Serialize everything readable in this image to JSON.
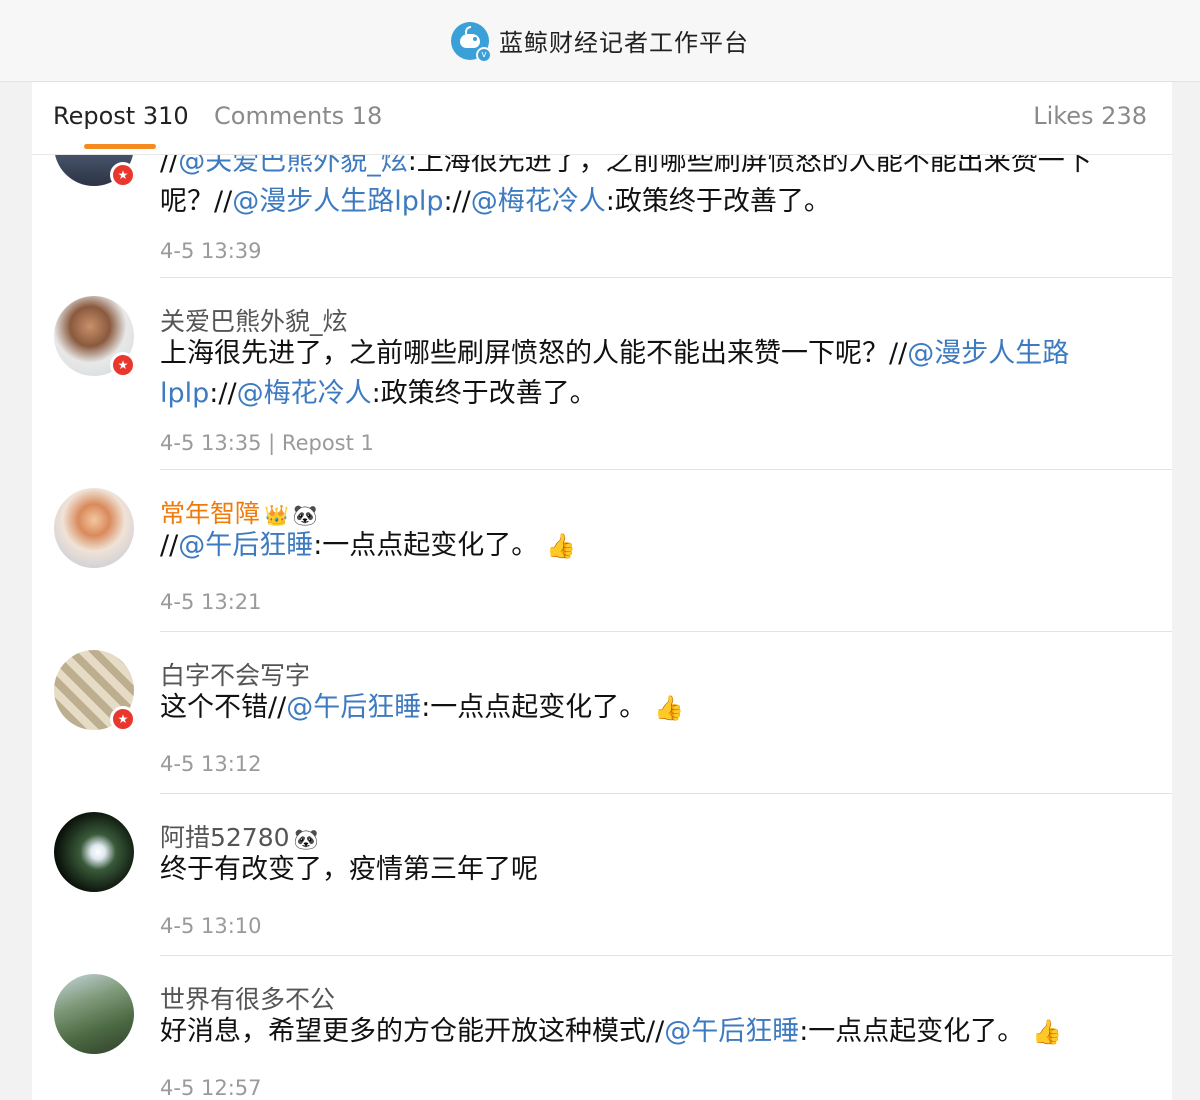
{
  "header": {
    "title": "蓝鲸财经记者工作平台",
    "logo_icon": "whale-logo-icon",
    "verified_mark": "v"
  },
  "tabs": {
    "repost": "Repost 310",
    "comments": "Comments 18",
    "likes": "Likes 238"
  },
  "colors": {
    "accent": "#f58a1f",
    "mention": "#3d7ac0",
    "vip_name": "#f07a0a",
    "badge": "#e8382e"
  },
  "posts": [
    {
      "seg1": "//",
      "seg2": "@关爱巴熊外貌_炫",
      "seg3": ":上海很先进了，之前哪些刷屏愤怒的人能不能出来赞一下呢？//",
      "seg4": "@漫步人生路lplp",
      "seg5": "://",
      "seg6": "@梅花冷人",
      "seg7": ":政策终于改善了。",
      "time": "4-5 13:39"
    },
    {
      "username": "关爱巴熊外貌_炫",
      "seg1": "上海很先进了，之前哪些刷屏愤怒的人能不能出来赞一下呢？//",
      "seg2": "@漫步人生路lplp",
      "seg3": "://",
      "seg4": "@梅花冷人",
      "seg5": ":政策终于改善了。",
      "time": "4-5 13:35 | Repost 1"
    },
    {
      "username": "常年智障",
      "seg1": "//",
      "seg2": "@午后狂睡",
      "seg3": ":一点点起变化了。",
      "time": "4-5 13:21"
    },
    {
      "username": "白字不会写字",
      "seg1": "这个不错//",
      "seg2": "@午后狂睡",
      "seg3": ":一点点起变化了。",
      "time": "4-5 13:12"
    },
    {
      "username": "阿措52780",
      "seg1": "终于有改变了，疫情第三年了呢",
      "time": "4-5 13:10"
    },
    {
      "username": "世界有很多不公",
      "seg1": "好消息，希望更多的方仓能开放这种模式//",
      "seg2": "@午后狂睡",
      "seg3": ":一点点起变化了。",
      "time": "4-5 12:57"
    }
  ]
}
